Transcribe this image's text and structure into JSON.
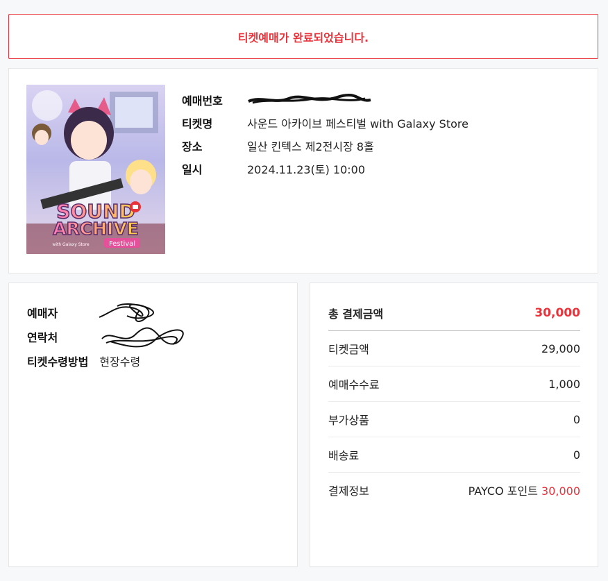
{
  "banner": {
    "message": "티켓예매가 완료되었습니다."
  },
  "ticket": {
    "poster": {
      "title_line1": "SOUND",
      "title_line2": "ARCHIVE",
      "tagline": "Festival",
      "sponsor": "with Galaxy Store"
    },
    "reservation_number_label": "예매번호",
    "ticket_name_label": "티켓명",
    "ticket_name": "사운드 아카이브 페스티벌 with Galaxy Store",
    "venue_label": "장소",
    "venue": "일산 킨텍스 제2전시장 8홀",
    "datetime_label": "일시",
    "datetime": "2024.11.23(토) 10:00"
  },
  "buyer": {
    "name_label": "예매자",
    "contact_label": "연락처",
    "delivery_label": "티켓수령방법",
    "delivery_method": "현장수령"
  },
  "payment": {
    "total_label": "총 결제금액",
    "total_amount": "30,000",
    "ticket_price_label": "티켓금액",
    "ticket_price": "29,000",
    "fee_label": "예매수수료",
    "fee": "1,000",
    "addon_label": "부가상품",
    "addon": "0",
    "shipping_label": "배송료",
    "shipping": "0",
    "method_label": "결제정보",
    "method_name": "PAYCO 포인트",
    "method_amount": "30,000"
  },
  "colors": {
    "accent": "#e8333b",
    "border": "#e6e6e6",
    "background": "#f7f8fa"
  }
}
